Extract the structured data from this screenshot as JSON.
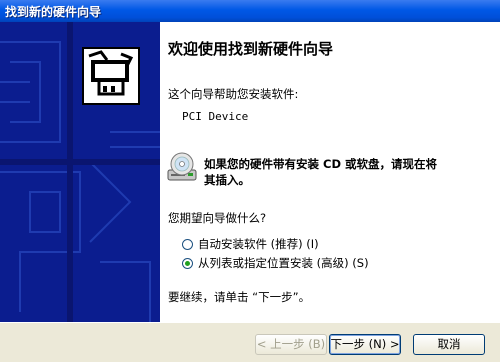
{
  "window": {
    "title": "找到新的硬件向导"
  },
  "content": {
    "heading": "欢迎使用找到新硬件向导",
    "intro": "这个向导帮助您安装软件:",
    "device_name": "PCI Device",
    "cd_hint_line1": "如果您的硬件带有安装 CD 或软盘，请现在将",
    "cd_hint_line2": "其插入。",
    "question": "您期望向导做什么?",
    "options": [
      {
        "label": "自动安装软件 (推荐) (I)",
        "selected": false
      },
      {
        "label": "从列表或指定位置安装 (高级) (S)",
        "selected": true
      }
    ],
    "continue_text": "要继续，请单击 “下一步”。"
  },
  "buttons": {
    "back": "< 上一步 (B)",
    "next": "下一步 (N) >",
    "cancel": "取消"
  },
  "icons": {
    "wizard_logo": "hardware-wizard-icon",
    "cd": "cd-drive-icon"
  },
  "colors": {
    "title_bar": "#0058e6",
    "side_panel": "#0a1a8c",
    "dialog_bg": "#ece9d8",
    "radio_dot": "#21a121"
  }
}
